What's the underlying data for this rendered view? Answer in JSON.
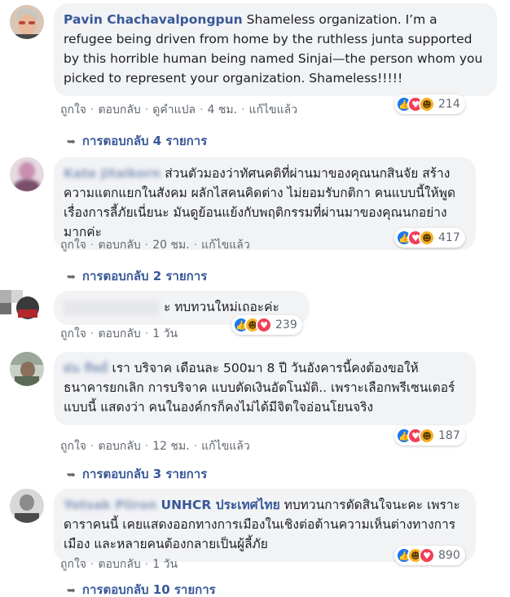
{
  "comments": [
    {
      "author": "Pavin Chachavalpongpun",
      "text": "Shameless organization. I’m a refugee being driven from home by the ruthless junta supported by this horrible human being named Sinjai—the person whom you picked to represent your organization. Shameless!!!!!",
      "actions": [
        "ถูกใจ",
        "ตอบกลับ",
        "ดูคำแปล",
        "4 ชม.",
        "แก้ไขแล้ว"
      ],
      "reaction_count": "214",
      "replies": "การตอบกลับ 4 รายการ"
    },
    {
      "author": "Kate Jitaikorn",
      "text": "ส่วนตัวมองว่าทัศนคติที่ผ่านมาของคุณนกสินจัย สร้างความแตกแยกในสังคม ผลักไสคนคิดต่าง ไม่ยอมรับกติกา คนแบบนี้ให้พูดเรื่องการลี้ภัยเนี่ยนะ มันดูย้อนแย้งกับพฤติกรรมที่ผ่านมาของคุณนกอย่างมากค่ะ",
      "actions": [
        "ถูกใจ",
        "ตอบกลับ",
        "20 ชม.",
        "แก้ไขแล้ว"
      ],
      "reaction_count": "417",
      "replies": "การตอบกลับ 2 รายการ"
    },
    {
      "author": "",
      "text": "ะ ทบทวนใหม่เถอะค่ะ",
      "actions": [
        "ถูกใจ",
        "ตอบกลับ",
        "1 วัน"
      ],
      "reaction_count": "239"
    },
    {
      "author": "ฝน ทิพย์",
      "text": "เรา บริจาค เดือนละ 500มา 8 ปี วันอังคารนี้คงต้องขอให้ธนาคารยกเลิก การบริจาค แบบตัดเงินอัตโนมัติ.. เพราะเลือกพรีเซนเตอร์แบบนี้ แสดงว่า คนในองค์กรก็คงไม่ได้มีจิตใจอ่อนโยนจริง",
      "actions": [
        "ถูกใจ",
        "ตอบกลับ",
        "12 ชม.",
        "แก้ไขแล้ว"
      ],
      "reaction_count": "187",
      "replies": "การตอบกลับ 3 รายการ"
    },
    {
      "author": "Yotsak Piiron",
      "target": "UNHCR ประเทศไทย",
      "text": "ทบทวนการตัดสินใจนะคะ เพราะดาราคนนี้ เคยแสดงออกทางการเมืองในเชิงต่อต้านความเห็นต่างทางการเมือง และหลายคนต้องกลายเป็นผู้ลี้ภัย",
      "actions": [
        "ถูกใจ",
        "ตอบกลับ",
        "1 วัน"
      ],
      "reaction_count": "890",
      "replies": "การตอบกลับ 10 รายการ"
    }
  ],
  "colors": {
    "author": "#385898",
    "bubble": "#f2f3f5",
    "meta": "#606770",
    "like": "#1877f2",
    "love": "#f33e58",
    "haha": "#f7b125"
  },
  "icons": {
    "reply_arrow": "reply-arrow-icon",
    "like": "like-icon",
    "love": "love-icon",
    "haha": "haha-icon"
  }
}
